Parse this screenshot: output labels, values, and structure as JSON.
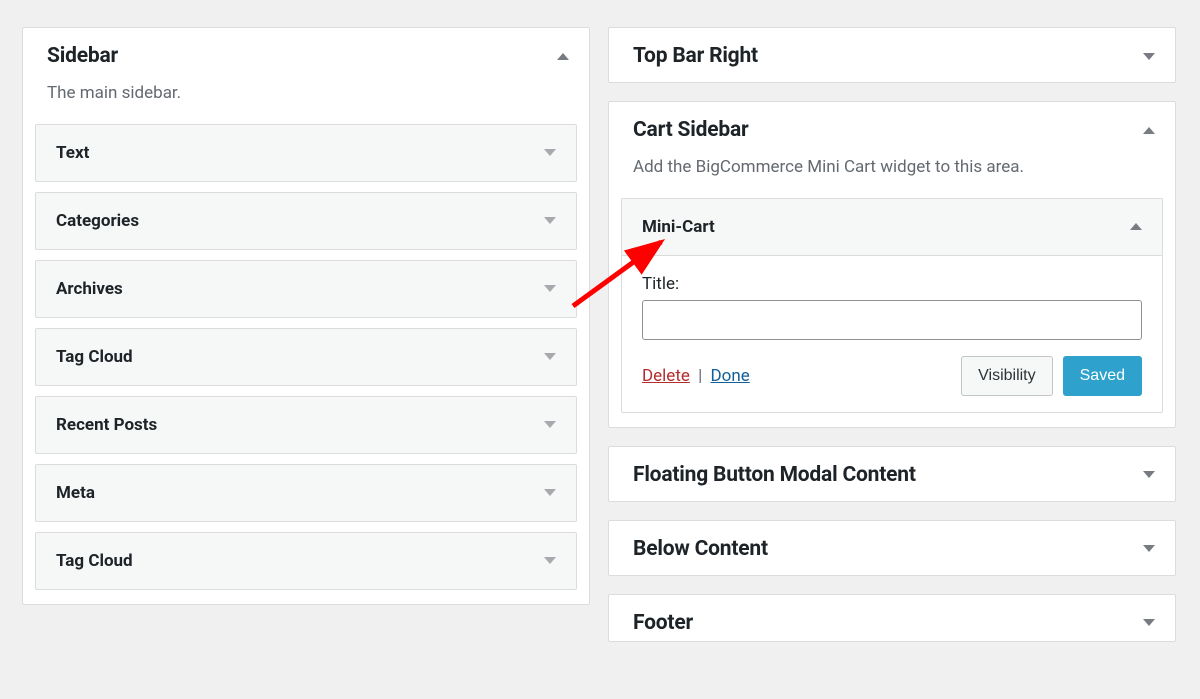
{
  "left": {
    "title": "Sidebar",
    "desc": "The main sidebar.",
    "widgets": [
      {
        "label": "Text"
      },
      {
        "label": "Categories"
      },
      {
        "label": "Archives"
      },
      {
        "label": "Tag Cloud"
      },
      {
        "label": "Recent Posts"
      },
      {
        "label": "Meta"
      },
      {
        "label": "Tag Cloud"
      }
    ]
  },
  "right": {
    "top_bar_right": {
      "title": "Top Bar Right"
    },
    "cart_sidebar": {
      "title": "Cart Sidebar",
      "desc": "Add the BigCommerce Mini Cart widget to this area.",
      "mini_cart": {
        "title": "Mini-Cart",
        "field_label": "Title:",
        "value": "",
        "delete": "Delete",
        "done": "Done",
        "visibility": "Visibility",
        "saved": "Saved"
      }
    },
    "floating": {
      "title": "Floating Button Modal Content"
    },
    "below": {
      "title": "Below Content"
    },
    "footer": {
      "title": "Footer"
    }
  }
}
